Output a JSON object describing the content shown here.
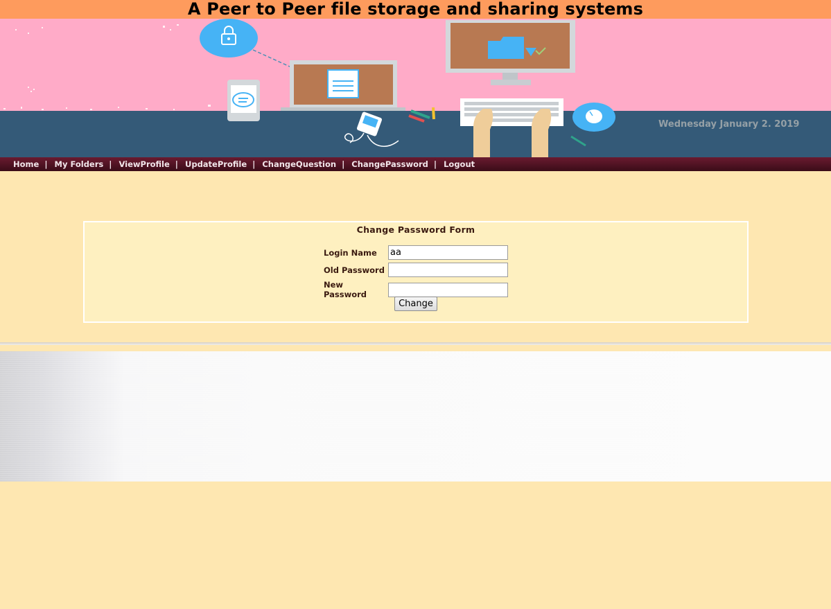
{
  "header": {
    "title": "A Peer to Peer file storage and sharing systems",
    "date": "Wednesday January 2. 2019"
  },
  "nav": {
    "separator": "|",
    "items": [
      {
        "label": "Home"
      },
      {
        "label": "My Folders"
      },
      {
        "label": "ViewProfile"
      },
      {
        "label": "UpdateProfile"
      },
      {
        "label": "ChangeQuestion"
      },
      {
        "label": "ChangePassword"
      },
      {
        "label": "Logout"
      }
    ]
  },
  "form": {
    "title": "Change Password Form",
    "login_name_label": "Login Name",
    "login_name_value": "aa",
    "old_password_label": "Old Password",
    "new_password_label": "New Password",
    "submit_label": "Change"
  },
  "colors": {
    "title_bar": "#fe9b5d",
    "banner_pink": "#ffabc8",
    "banner_desk": "#345a78",
    "nav_bg": "#5a1428",
    "page_bg": "#fee7b1",
    "form_bg": "#fef0c0"
  },
  "icons": [
    "lock-icon",
    "document-icon",
    "folder-download-icon",
    "chat-icon",
    "mouse-icon",
    "keyboard-icon",
    "music-player-icon"
  ]
}
